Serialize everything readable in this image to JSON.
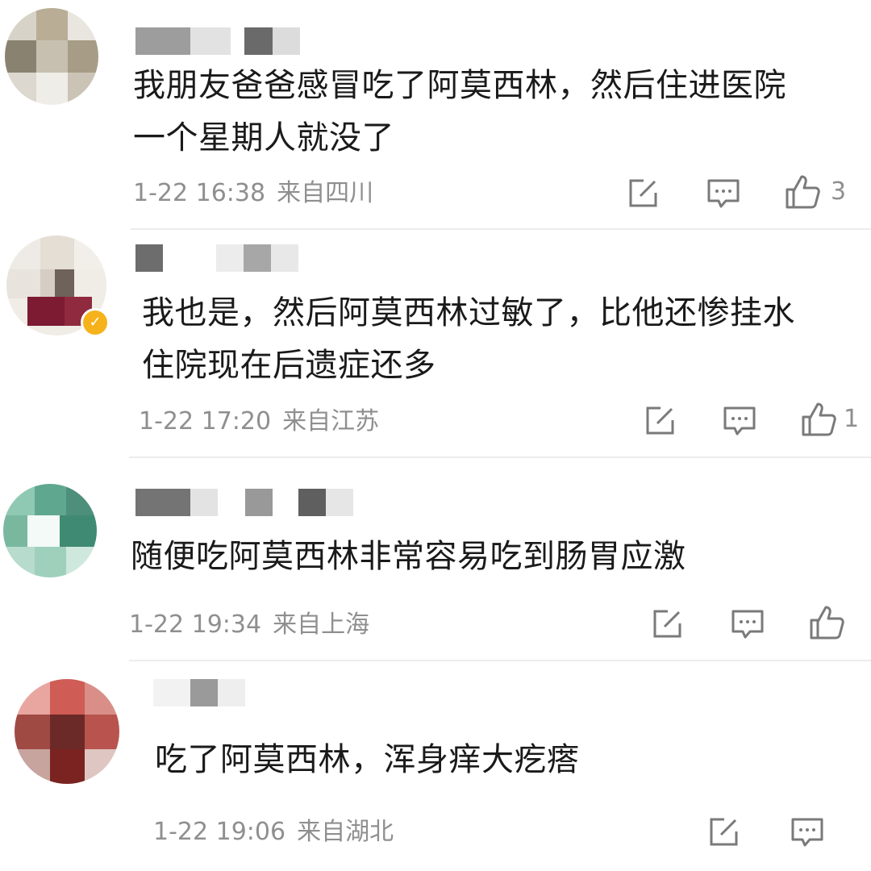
{
  "comments": [
    {
      "text_lines": [
        "我朋友爸爸感冒吃了阿莫西林，然后住进医院",
        "一个星期人就没了"
      ],
      "time": "1-22 16:38",
      "location": "来自四川",
      "likes": "3",
      "avatar_colors": [
        "#d8d3c8",
        "#b9ad95",
        "#8a8270",
        "#e9e6e0",
        "#c7c0b1",
        "#a79d86",
        "#dcd8cf",
        "#efede8",
        "#cbc4b6"
      ]
    },
    {
      "text_lines": [
        "我也是，然后阿莫西林过敏了，比他还惨挂水",
        "住院现在后遗症还多"
      ],
      "time": "1-22 17:20",
      "location": "来自江苏",
      "likes": "1",
      "verified": "✓",
      "avatar_colors": [
        "#eeebe6",
        "#e4ded5",
        "#f2efea",
        "#e8e3dc",
        "#d6cec4",
        "#6f625a",
        "#f0ece6",
        "#7c1b32",
        "#8f2a3f"
      ]
    },
    {
      "text_lines": [
        "随便吃阿莫西林非常容易吃到肠胃应激"
      ],
      "time": "1-22 19:34",
      "location": "来自上海",
      "likes": "",
      "avatar_colors": [
        "#8fc9b4",
        "#5fa88f",
        "#4d8f7a",
        "#3f8a72",
        "#f3faf7",
        "#79b89f",
        "#b7dccd",
        "#9ed0bc",
        "#cfe8de"
      ]
    },
    {
      "text_lines": [
        "吃了阿莫西林，浑身痒大疙瘩"
      ],
      "time": "1-22 19:06",
      "location": "来自湖北",
      "avatar_colors": [
        "#e9a6a0",
        "#cf5c55",
        "#d98f88",
        "#a04a44",
        "#6b2a28",
        "#b8544d",
        "#c8a49f",
        "#7a2320",
        "#dfc6c2"
      ]
    }
  ],
  "icon_color": "#7a7a7a"
}
